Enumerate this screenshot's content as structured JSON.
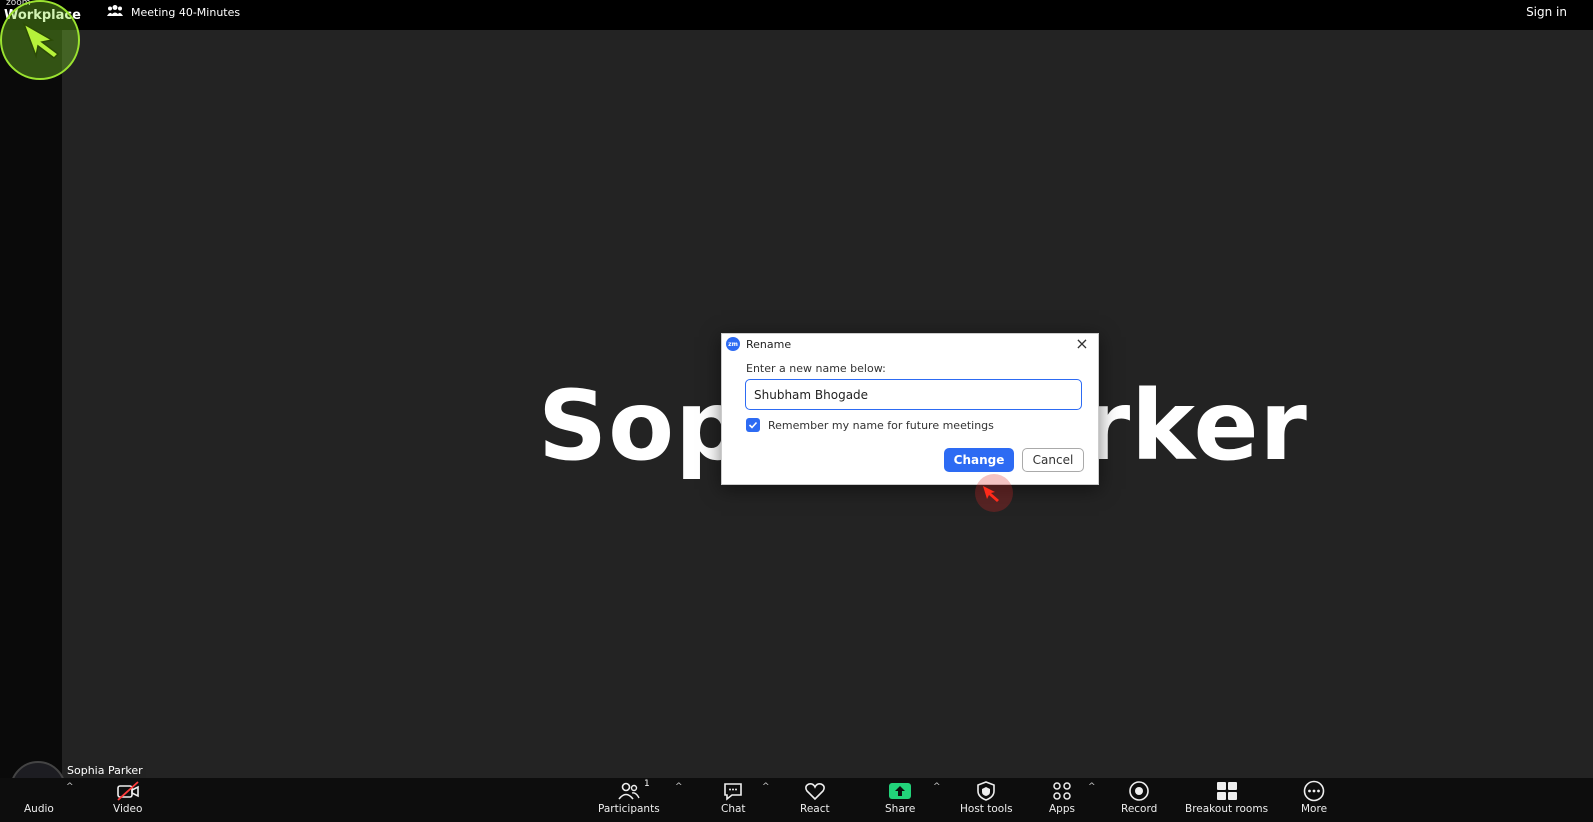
{
  "topbar": {
    "brand_small": "zoom",
    "brand_big": "Workplace",
    "meeting_title": "Meeting 40-Minutes",
    "signin_label": "Sign in"
  },
  "stage": {
    "participant_display_name": "Sophia Parker"
  },
  "dialog": {
    "title": "Rename",
    "badge": "zm",
    "prompt": "Enter a new name below:",
    "input_value": "Shubham Bhogade",
    "remember_label": "Remember my name for future meetings",
    "remember_checked": true,
    "change_label": "Change",
    "cancel_label": "Cancel"
  },
  "self_tile": {
    "name": "Sophia Parker"
  },
  "toolbar": {
    "items": [
      {
        "label": "Audio"
      },
      {
        "label": "Video"
      },
      {
        "label": "Participants",
        "count": "1"
      },
      {
        "label": "Chat"
      },
      {
        "label": "React"
      },
      {
        "label": "Share"
      },
      {
        "label": "Host tools"
      },
      {
        "label": "Apps"
      },
      {
        "label": "Record"
      },
      {
        "label": "Breakout rooms"
      },
      {
        "label": "More"
      }
    ]
  },
  "colors": {
    "accent": "#2d6bf3",
    "stage_bg": "#232323",
    "share_green": "#22d37a",
    "highlight_green": "#9be330",
    "click_red": "#dc2828"
  }
}
